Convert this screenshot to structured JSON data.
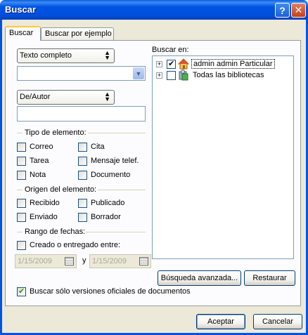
{
  "window": {
    "title": "Buscar",
    "help_glyph": "?",
    "close_glyph": "✕"
  },
  "tabs": [
    {
      "label": "Buscar",
      "active": true
    },
    {
      "label": "Buscar por ejemplo",
      "active": false
    }
  ],
  "search": {
    "scope_value": "Texto completo",
    "query_value": "",
    "author_field_value": "De/Autor",
    "author_value": ""
  },
  "element_type": {
    "label": "Tipo de elemento:",
    "options": [
      {
        "label": "Correo",
        "checked": false
      },
      {
        "label": "Cita",
        "checked": false
      },
      {
        "label": "Tarea",
        "checked": false
      },
      {
        "label": "Mensaje telef.",
        "checked": false
      },
      {
        "label": "Nota",
        "checked": false
      },
      {
        "label": "Documento",
        "checked": false
      }
    ]
  },
  "element_origin": {
    "label": "Origen del elemento:",
    "options": [
      {
        "label": "Recibido",
        "checked": false
      },
      {
        "label": "Publicado",
        "checked": false
      },
      {
        "label": "Enviado",
        "checked": false
      },
      {
        "label": "Borrador",
        "checked": false
      }
    ]
  },
  "date_range": {
    "label": "Rango de fechas:",
    "created_label": "Creado o entregado entre:",
    "created_checked": false,
    "from": "1/15/2009",
    "and_label": "y",
    "to": "1/15/2009"
  },
  "search_in": {
    "label": "Buscar en:",
    "tree": [
      {
        "label": "admin admin Particular",
        "checked": true,
        "icon": "house-icon",
        "expander": "+"
      },
      {
        "label": "Todas las bibliotecas",
        "checked": false,
        "icon": "library-icon",
        "expander": "+"
      }
    ]
  },
  "buttons": {
    "advanced": "Búsqueda avanzada...",
    "restore": "Restaurar",
    "accept": "Aceptar",
    "cancel": "Cancelar"
  },
  "official_only": {
    "label": "Buscar sólo versiones oficiales de documentos",
    "checked": true
  },
  "colors": {
    "titlebar": "#0054e3",
    "dialog_bg": "#ece9d8",
    "panel_bg": "#fcfcfe"
  }
}
